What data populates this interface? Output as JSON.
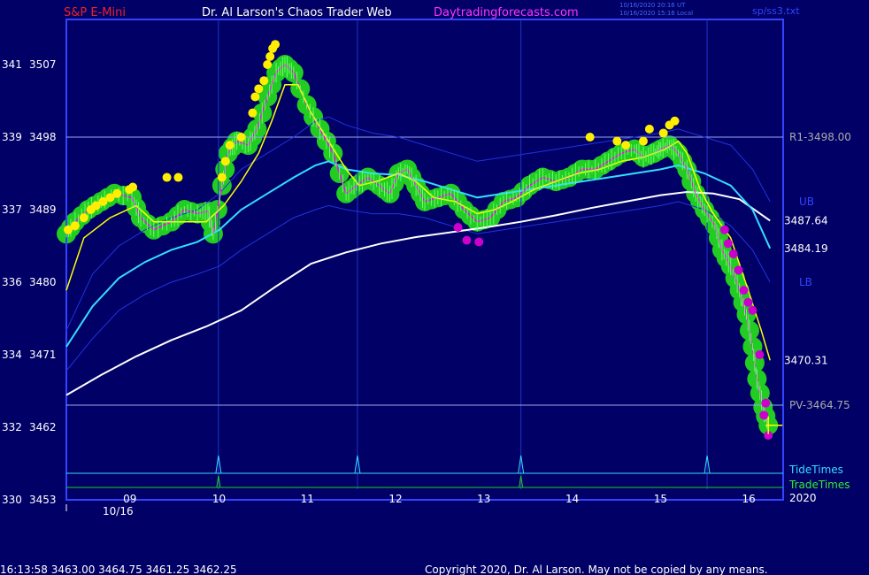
{
  "header": {
    "symbol": "S&P E-Mini",
    "site_title": "Dr. Al Larson's Chaos Trader Web",
    "site_url": "Daytradingforecasts.com",
    "ut_stamp": "10/16/2020 20:16 UT",
    "local_stamp": "10/16/2020 15:16 Local",
    "filename": "sp/ss3.txt"
  },
  "footer": {
    "quote": "16:13:58  3463.00 3464.75 3461.25 3462.25",
    "copyright": "Copyright 2020, Dr. Al Larson. May not be copied by any means."
  },
  "colors": {
    "background": "#000066",
    "frame": "#3344ff",
    "price_line": "#ff00ff",
    "fast_average": "#ffff00",
    "cyan_average": "#33ddff",
    "white_average": "#ffffff",
    "band": "#2233dd",
    "up_marker": "#ffee00",
    "down_marker": "#cc00cc",
    "energy": "#22cc22"
  },
  "chart_data": {
    "type": "line",
    "title": "S&P E-Mini",
    "x_unit": "hour of day",
    "xlim": [
      8.0,
      16.2
    ],
    "ylim": [
      3453,
      3516
    ],
    "y_ticks": [
      {
        "left": "341",
        "price": 3507
      },
      {
        "left": "339",
        "price": 3498
      },
      {
        "left": "337",
        "price": 3489
      },
      {
        "left": "336",
        "price": 3480
      },
      {
        "left": "334",
        "price": 3471
      },
      {
        "left": "332",
        "price": 3462
      },
      {
        "left": "330",
        "price": 3453
      }
    ],
    "x_ticks": [
      {
        "label": "09",
        "x": 8.72
      },
      {
        "label": "10",
        "x": 9.74
      },
      {
        "label": "11",
        "x": 10.75
      },
      {
        "label": "12",
        "x": 11.76
      },
      {
        "label": "13",
        "x": 12.77
      },
      {
        "label": "14",
        "x": 13.78
      },
      {
        "label": "15",
        "x": 14.79
      },
      {
        "label": "16",
        "x": 15.8
      }
    ],
    "date_label": "10/16",
    "year_label": "2020",
    "vertical_lines": [
      9.74,
      11.33,
      13.2,
      15.33
    ],
    "horizontal_levels": [
      {
        "label": "R1-3498.00",
        "price": 3498.0
      },
      {
        "label": "PV-3464.75",
        "price": 3464.75
      }
    ],
    "band_labels": [
      {
        "label": "UB",
        "price": 3490
      },
      {
        "label": "LB",
        "price": 3480
      }
    ],
    "series": [
      {
        "key": "price",
        "points": [
          [
            8.0,
            3486
          ],
          [
            8.1,
            3487.5
          ],
          [
            8.25,
            3489
          ],
          [
            8.4,
            3490
          ],
          [
            8.55,
            3491
          ],
          [
            8.75,
            3490.5
          ],
          [
            8.85,
            3488
          ],
          [
            9.0,
            3486.5
          ],
          [
            9.2,
            3487.5
          ],
          [
            9.35,
            3489
          ],
          [
            9.5,
            3488.5
          ],
          [
            9.62,
            3488.8
          ],
          [
            9.68,
            3486
          ],
          [
            9.78,
            3492
          ],
          [
            9.85,
            3496
          ],
          [
            9.95,
            3497.5
          ],
          [
            10.08,
            3497
          ],
          [
            10.18,
            3499
          ],
          [
            10.3,
            3503
          ],
          [
            10.4,
            3506
          ],
          [
            10.5,
            3507
          ],
          [
            10.6,
            3506
          ],
          [
            10.75,
            3502
          ],
          [
            10.9,
            3499
          ],
          [
            11.05,
            3496
          ],
          [
            11.2,
            3491
          ],
          [
            11.32,
            3492
          ],
          [
            11.45,
            3493
          ],
          [
            11.58,
            3492
          ],
          [
            11.7,
            3491
          ],
          [
            11.8,
            3493.5
          ],
          [
            11.9,
            3494
          ],
          [
            12.0,
            3492
          ],
          [
            12.1,
            3490
          ],
          [
            12.25,
            3490.5
          ],
          [
            12.4,
            3491
          ],
          [
            12.55,
            3489
          ],
          [
            12.7,
            3487.5
          ],
          [
            12.85,
            3488
          ],
          [
            13.0,
            3490
          ],
          [
            13.15,
            3490.5
          ],
          [
            13.3,
            3492
          ],
          [
            13.45,
            3493
          ],
          [
            13.6,
            3492.5
          ],
          [
            13.75,
            3493
          ],
          [
            13.9,
            3494
          ],
          [
            14.05,
            3494
          ],
          [
            14.2,
            3495
          ],
          [
            14.35,
            3496
          ],
          [
            14.5,
            3496.5
          ],
          [
            14.6,
            3495.5
          ],
          [
            14.72,
            3496
          ],
          [
            14.8,
            3496.5
          ],
          [
            14.9,
            3497
          ],
          [
            15.0,
            3496
          ],
          [
            15.1,
            3494
          ],
          [
            15.2,
            3491
          ],
          [
            15.3,
            3489
          ],
          [
            15.42,
            3487
          ],
          [
            15.5,
            3484
          ],
          [
            15.6,
            3482
          ],
          [
            15.7,
            3479
          ],
          [
            15.78,
            3476
          ],
          [
            15.85,
            3472
          ],
          [
            15.9,
            3468
          ],
          [
            15.97,
            3464.5
          ],
          [
            16.03,
            3462.25
          ]
        ],
        "line_type": "jagged"
      },
      {
        "key": "fast_average",
        "points": [
          [
            8.0,
            3479
          ],
          [
            8.2,
            3485.5
          ],
          [
            8.5,
            3488
          ],
          [
            8.8,
            3489.5
          ],
          [
            9.0,
            3487.5
          ],
          [
            9.3,
            3487.5
          ],
          [
            9.6,
            3487.5
          ],
          [
            9.8,
            3489.5
          ],
          [
            10.0,
            3492.5
          ],
          [
            10.2,
            3496
          ],
          [
            10.35,
            3500
          ],
          [
            10.5,
            3504.5
          ],
          [
            10.65,
            3504.5
          ],
          [
            10.8,
            3501
          ],
          [
            11.0,
            3497.5
          ],
          [
            11.2,
            3494
          ],
          [
            11.35,
            3492
          ],
          [
            11.55,
            3492.5
          ],
          [
            11.8,
            3493.5
          ],
          [
            12.0,
            3492.5
          ],
          [
            12.2,
            3490.5
          ],
          [
            12.45,
            3490
          ],
          [
            12.7,
            3488.5
          ],
          [
            12.9,
            3489
          ],
          [
            13.1,
            3490
          ],
          [
            13.35,
            3491.5
          ],
          [
            13.6,
            3492.5
          ],
          [
            13.85,
            3493.5
          ],
          [
            14.1,
            3494
          ],
          [
            14.35,
            3495
          ],
          [
            14.6,
            3495.5
          ],
          [
            14.85,
            3496.5
          ],
          [
            15.0,
            3497.5
          ],
          [
            15.1,
            3496
          ],
          [
            15.25,
            3491.5
          ],
          [
            15.4,
            3488.5
          ],
          [
            15.6,
            3485.5
          ],
          [
            15.8,
            3479
          ],
          [
            15.95,
            3474
          ],
          [
            16.05,
            3470.31
          ]
        ]
      },
      {
        "key": "cyan_average",
        "points": [
          [
            8.0,
            3472
          ],
          [
            8.3,
            3477
          ],
          [
            8.6,
            3480.5
          ],
          [
            8.9,
            3482.5
          ],
          [
            9.2,
            3484
          ],
          [
            9.5,
            3485
          ],
          [
            9.75,
            3486.5
          ],
          [
            10.0,
            3489
          ],
          [
            10.3,
            3491
          ],
          [
            10.6,
            3493
          ],
          [
            10.85,
            3494.5
          ],
          [
            11.0,
            3495
          ],
          [
            11.2,
            3494
          ],
          [
            11.5,
            3493.5
          ],
          [
            11.8,
            3493.3
          ],
          [
            12.1,
            3492.5
          ],
          [
            12.4,
            3491.5
          ],
          [
            12.7,
            3490.5
          ],
          [
            13.0,
            3491
          ],
          [
            13.3,
            3491.5
          ],
          [
            13.6,
            3492
          ],
          [
            13.9,
            3492.5
          ],
          [
            14.2,
            3493
          ],
          [
            14.5,
            3493.5
          ],
          [
            14.8,
            3494
          ],
          [
            15.0,
            3494.5
          ],
          [
            15.3,
            3493.5
          ],
          [
            15.6,
            3492
          ],
          [
            15.85,
            3489
          ],
          [
            16.05,
            3484.19
          ]
        ]
      },
      {
        "key": "white_average",
        "points": [
          [
            8.0,
            3466
          ],
          [
            8.4,
            3468.5
          ],
          [
            8.8,
            3470.8
          ],
          [
            9.2,
            3472.8
          ],
          [
            9.6,
            3474.5
          ],
          [
            10.0,
            3476.5
          ],
          [
            10.4,
            3479.5
          ],
          [
            10.8,
            3482.3
          ],
          [
            11.2,
            3483.7
          ],
          [
            11.6,
            3484.8
          ],
          [
            12.0,
            3485.6
          ],
          [
            12.4,
            3486.2
          ],
          [
            12.8,
            3486.8
          ],
          [
            13.2,
            3487.5
          ],
          [
            13.6,
            3488.3
          ],
          [
            14.0,
            3489.2
          ],
          [
            14.4,
            3490.0
          ],
          [
            14.8,
            3490.8
          ],
          [
            15.1,
            3491.2
          ],
          [
            15.4,
            3491
          ],
          [
            15.7,
            3490.3
          ],
          [
            16.05,
            3487.64
          ]
        ]
      },
      {
        "key": "upper_band",
        "points": [
          [
            8.0,
            3474
          ],
          [
            8.3,
            3481
          ],
          [
            8.6,
            3484.5
          ],
          [
            8.9,
            3486.5
          ],
          [
            9.2,
            3488
          ],
          [
            9.5,
            3489
          ],
          [
            9.75,
            3491
          ],
          [
            10.0,
            3494
          ],
          [
            10.3,
            3496
          ],
          [
            10.6,
            3498
          ],
          [
            10.85,
            3500
          ],
          [
            11.0,
            3500.5
          ],
          [
            11.2,
            3499.5
          ],
          [
            11.5,
            3498.5
          ],
          [
            11.8,
            3498
          ],
          [
            12.1,
            3497
          ],
          [
            12.4,
            3496
          ],
          [
            12.7,
            3495
          ],
          [
            13.0,
            3495.5
          ],
          [
            13.3,
            3496
          ],
          [
            13.6,
            3496.5
          ],
          [
            13.9,
            3497
          ],
          [
            14.2,
            3497.5
          ],
          [
            14.5,
            3498
          ],
          [
            14.8,
            3498.5
          ],
          [
            15.0,
            3499
          ],
          [
            15.3,
            3498
          ],
          [
            15.6,
            3497
          ],
          [
            15.85,
            3494
          ],
          [
            16.05,
            3490
          ]
        ]
      },
      {
        "key": "lower_band",
        "points": [
          [
            8.0,
            3469
          ],
          [
            8.3,
            3473
          ],
          [
            8.6,
            3476.5
          ],
          [
            8.9,
            3478.5
          ],
          [
            9.2,
            3480
          ],
          [
            9.5,
            3481
          ],
          [
            9.75,
            3482
          ],
          [
            10.0,
            3484
          ],
          [
            10.3,
            3486
          ],
          [
            10.6,
            3488
          ],
          [
            10.85,
            3489
          ],
          [
            11.0,
            3489.5
          ],
          [
            11.2,
            3489
          ],
          [
            11.5,
            3488.5
          ],
          [
            11.8,
            3488.5
          ],
          [
            12.1,
            3488
          ],
          [
            12.4,
            3487
          ],
          [
            12.7,
            3486
          ],
          [
            13.0,
            3486.5
          ],
          [
            13.3,
            3487
          ],
          [
            13.6,
            3487.5
          ],
          [
            13.9,
            3488
          ],
          [
            14.2,
            3488.5
          ],
          [
            14.5,
            3489
          ],
          [
            14.8,
            3489.5
          ],
          [
            15.0,
            3490
          ],
          [
            15.3,
            3489
          ],
          [
            15.6,
            3487
          ],
          [
            15.85,
            3484
          ],
          [
            16.05,
            3480
          ]
        ]
      }
    ],
    "value_labels": [
      {
        "label": "3487.64",
        "price": 3487.64
      },
      {
        "label": "3484.19",
        "price": 3484.19
      },
      {
        "label": "3470.31",
        "price": 3470.31
      }
    ],
    "up_markers": [
      [
        8.02,
        3486.5
      ],
      [
        8.1,
        3487
      ],
      [
        8.2,
        3488
      ],
      [
        8.28,
        3489
      ],
      [
        8.34,
        3489.5
      ],
      [
        8.42,
        3490
      ],
      [
        8.5,
        3490.5
      ],
      [
        8.58,
        3491
      ],
      [
        8.72,
        3491.5
      ],
      [
        8.76,
        3491.8
      ],
      [
        9.15,
        3493
      ],
      [
        9.28,
        3493
      ],
      [
        9.78,
        3493
      ],
      [
        9.82,
        3495
      ],
      [
        9.87,
        3497
      ],
      [
        10.0,
        3498
      ],
      [
        10.13,
        3501
      ],
      [
        10.16,
        3503
      ],
      [
        10.2,
        3504
      ],
      [
        10.26,
        3505
      ],
      [
        10.3,
        3507
      ],
      [
        10.33,
        3508
      ],
      [
        10.36,
        3509
      ],
      [
        10.39,
        3509.5
      ],
      [
        13.99,
        3498
      ],
      [
        14.3,
        3497.5
      ],
      [
        14.4,
        3497
      ],
      [
        14.6,
        3497.5
      ],
      [
        14.67,
        3499
      ],
      [
        14.83,
        3498.5
      ],
      [
        14.9,
        3499.5
      ],
      [
        14.96,
        3500
      ]
    ],
    "down_markers": [
      [
        12.48,
        3486.8
      ],
      [
        12.58,
        3485.2
      ],
      [
        12.72,
        3485
      ],
      [
        15.53,
        3486.5
      ],
      [
        15.57,
        3484.8
      ],
      [
        15.63,
        3483.5
      ],
      [
        15.69,
        3481.5
      ],
      [
        15.75,
        3479
      ],
      [
        15.8,
        3477.5
      ],
      [
        15.85,
        3476.5
      ],
      [
        15.93,
        3471
      ],
      [
        16.0,
        3465
      ],
      [
        15.98,
        3463.5
      ],
      [
        16.03,
        3461
      ]
    ],
    "energy_blob_indices": [
      0,
      1,
      2,
      3,
      4,
      5,
      6,
      7,
      8,
      9,
      10,
      11,
      12,
      13,
      14,
      15,
      16,
      17,
      18,
      19,
      20,
      21,
      22,
      23,
      24,
      25,
      26,
      27,
      28,
      29,
      30,
      31,
      32,
      33,
      34,
      35,
      36,
      37,
      38,
      39,
      40,
      41,
      42,
      43,
      44,
      45,
      46,
      47,
      48,
      49,
      50,
      51,
      52,
      53,
      54,
      55,
      56,
      57,
      58,
      59,
      60,
      61,
      62,
      63,
      64,
      65,
      66
    ],
    "bottom_panel": {
      "labels": [
        "TideTimes",
        "TradeTimes"
      ],
      "tide_spikes": [
        9.74,
        11.33,
        13.2,
        15.33
      ],
      "trade_spikes": [
        9.74,
        13.2
      ]
    }
  }
}
